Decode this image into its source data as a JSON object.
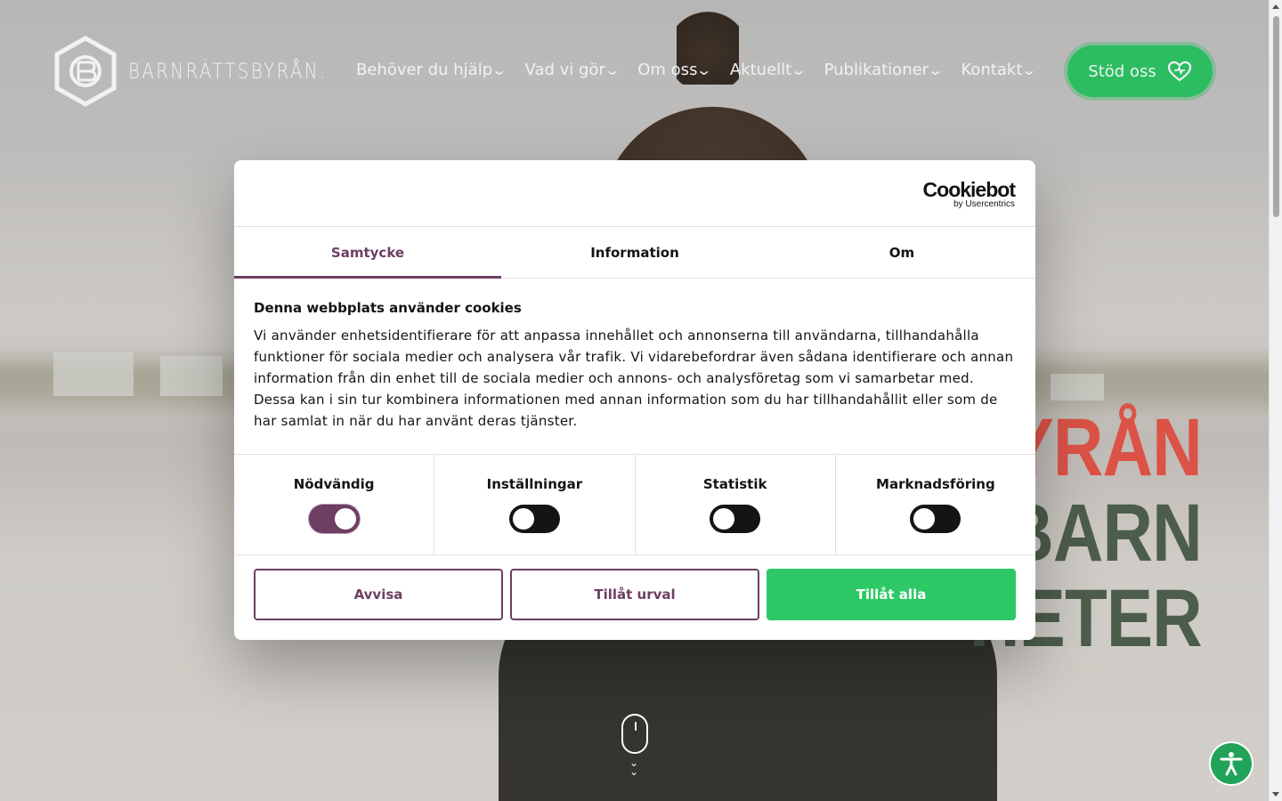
{
  "header": {
    "logo_text": "BARNRÄTTSBYRÅN.",
    "nav": [
      {
        "label": "Behöver du hjälp"
      },
      {
        "label": "Vad vi gör"
      },
      {
        "label": "Om oss"
      },
      {
        "label": "Aktuellt"
      },
      {
        "label": "Publikationer"
      },
      {
        "label": "Kontakt"
      }
    ],
    "support_button": "Stöd oss"
  },
  "hero": {
    "headline_lines": [
      "YRÅN",
      "BARN",
      "HETER"
    ]
  },
  "cookie_dialog": {
    "brand": "Cookiebot",
    "brand_sub": "by Usercentrics",
    "tabs": [
      {
        "label": "Samtycke",
        "active": true
      },
      {
        "label": "Information",
        "active": false
      },
      {
        "label": "Om",
        "active": false
      }
    ],
    "title": "Denna webbplats använder cookies",
    "description": "Vi använder enhetsidentifierare för att anpassa innehållet och annonserna till användarna, tillhandahålla funktioner för sociala medier och analysera vår trafik. Vi vidarebefordrar även sådana identifierare och annan information från din enhet till de sociala medier och annons- och analysföretag som vi samarbetar med. Dessa kan i sin tur kombinera informationen med annan information som du har tillhandahållit eller som de har samlat in när du har använt deras tjänster.",
    "categories": [
      {
        "label": "Nödvändig",
        "enabled": true
      },
      {
        "label": "Inställningar",
        "enabled": false
      },
      {
        "label": "Statistik",
        "enabled": false
      },
      {
        "label": "Marknadsföring",
        "enabled": false
      }
    ],
    "buttons": {
      "reject": "Avvisa",
      "allow_selection": "Tillåt urval",
      "allow_all": "Tillåt alla"
    }
  },
  "colors": {
    "accent_purple": "#6c3f63",
    "accent_green": "#2ec866",
    "headline_red": "#e8574a",
    "headline_green": "#526350"
  },
  "icons": {
    "support": "heart-icon",
    "accessibility": "accessibility-icon",
    "scroll": "mouse-icon"
  }
}
